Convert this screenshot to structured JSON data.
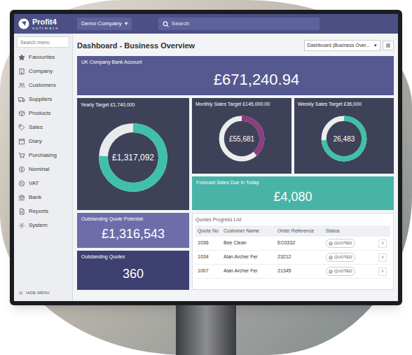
{
  "app": {
    "logo_name": "Profit4",
    "logo_tagline": "software",
    "company": "Demo Company",
    "company_caret": "▾",
    "search_placeholder": "Search",
    "dashboard_select": "Dashboard (Business Over...",
    "dashboard_caret": "▾"
  },
  "page_title": "Dashboard - Business Overview",
  "sidebar": {
    "search_placeholder": "Search menu",
    "items": [
      {
        "label": "Favourites"
      },
      {
        "label": "Company"
      },
      {
        "label": "Customers"
      },
      {
        "label": "Suppliers"
      },
      {
        "label": "Products"
      },
      {
        "label": "Sales"
      },
      {
        "label": "Diary"
      },
      {
        "label": "Purchasing"
      },
      {
        "label": "Nominal"
      },
      {
        "label": "VAT"
      },
      {
        "label": "Bank"
      },
      {
        "label": "Reports"
      },
      {
        "label": "System"
      }
    ],
    "hide_menu": "HIDE MENU"
  },
  "cards": {
    "bank": {
      "title": "UK Company Bank Account",
      "value": "£671,240.94"
    },
    "yearly": {
      "title": "Yearly Target £1,740,000",
      "value": "£1,317,092",
      "level": 0.757
    },
    "monthly": {
      "title": "Monthly Sales Target £145,000.00",
      "value": "£55,681",
      "level": 0.384
    },
    "weekly": {
      "title": "Weekly Sales Target £36,000",
      "value": "26,483",
      "level": 0.736
    },
    "forecast": {
      "title": "Forecast Sales Due In Today",
      "value": "£4,080"
    },
    "quote_potential": {
      "title": "Outstanding Quote Potential",
      "value": "£1,316,543"
    },
    "outstanding_quotes": {
      "title": "Outstanding Quotes",
      "value": "360"
    }
  },
  "quotes_table": {
    "title": "Quotes Progress List",
    "columns": [
      "Quote No",
      "Customer Name",
      "Order Reference",
      "Status"
    ],
    "rows": [
      {
        "cells": [
          "1036",
          "Bee Clean",
          "EC0332"
        ],
        "status": "QUOTED",
        "action": "›"
      },
      {
        "cells": [
          "1034",
          "Alan Archer Fer",
          "23212"
        ],
        "status": "QUOTED",
        "action": "›"
      },
      {
        "cells": [
          "1007",
          "Alan Archer Fer",
          "21345"
        ],
        "status": "QUOTED",
        "action": "›"
      }
    ]
  }
}
